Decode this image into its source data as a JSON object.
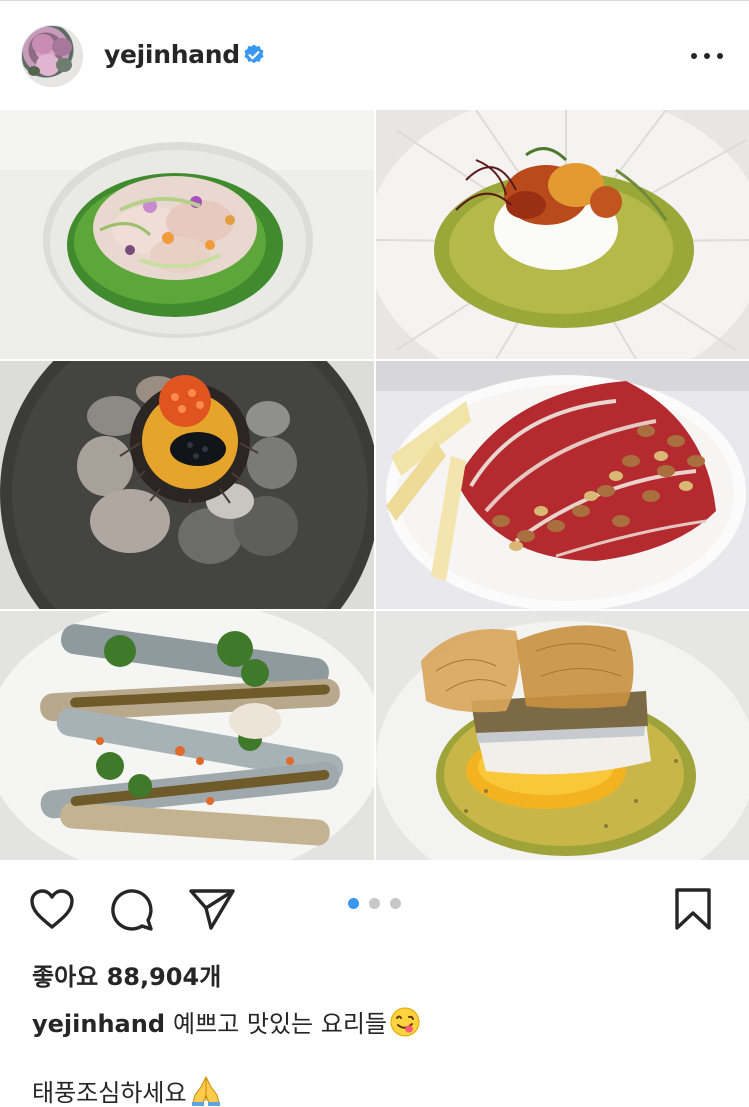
{
  "post": {
    "username": "yejinhand",
    "verified": true,
    "likes_text": "좋아요 88,904개",
    "caption_user": "yejinhand",
    "caption_text": "예쁘고 맛있는 요리들",
    "caption_emoji": "face-savoring-food",
    "caption_line2": "태풍조심하세요",
    "caption_line2_emoji": "folded-hands"
  },
  "carousel": {
    "total": 3,
    "active_index": 0,
    "active_color": "#3897f0",
    "inactive_color": "#c7c7c7"
  },
  "images": [
    {
      "name": "fish-crudo-on-herb-oil"
    },
    {
      "name": "sea-urchin-on-burrata"
    },
    {
      "name": "sea-urchin-caviar-on-stones"
    },
    {
      "name": "jamon-cheese-almond-plate"
    },
    {
      "name": "razor-clams-with-herbs"
    },
    {
      "name": "fish-with-crispy-skin-and-sauce"
    }
  ],
  "icons": [
    "heart-icon",
    "comment-icon",
    "share-icon",
    "bookmark-icon",
    "more-options-icon",
    "verified-badge-icon"
  ]
}
